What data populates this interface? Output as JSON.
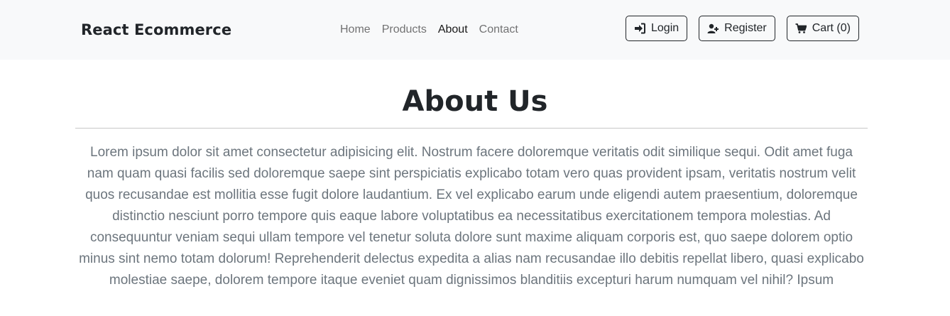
{
  "brand": "React Ecommerce",
  "nav": {
    "items": [
      {
        "label": "Home",
        "active": false
      },
      {
        "label": "Products",
        "active": false
      },
      {
        "label": "About",
        "active": true
      },
      {
        "label": "Contact",
        "active": false
      }
    ]
  },
  "actions": {
    "login": "Login",
    "register": "Register",
    "cart": "Cart (0)"
  },
  "page": {
    "title": "About Us",
    "body": "Lorem ipsum dolor sit amet consectetur adipisicing elit. Nostrum facere doloremque veritatis odit similique sequi. Odit amet fuga nam quam quasi facilis sed doloremque saepe sint perspiciatis explicabo totam vero quas provident ipsam, veritatis nostrum velit quos recusandae est mollitia esse fugit dolore laudantium. Ex vel explicabo earum unde eligendi autem praesentium, doloremque distinctio nesciunt porro tempore quis eaque labore voluptatibus ea necessitatibus exercitationem tempora molestias. Ad consequuntur veniam sequi ullam tempore vel tenetur soluta dolore sunt maxime aliquam corporis est, quo saepe dolorem optio minus sint nemo totam dolorum! Reprehenderit delectus expedita a alias nam recusandae illo debitis repellat libero, quasi explicabo molestiae saepe, dolorem tempore itaque eveniet quam dignissimos blanditiis excepturi harum numquam vel nihil? Ipsum"
  },
  "icons": {
    "login": "sign-in-icon",
    "register": "user-plus-icon",
    "cart": "shopping-cart-icon"
  }
}
